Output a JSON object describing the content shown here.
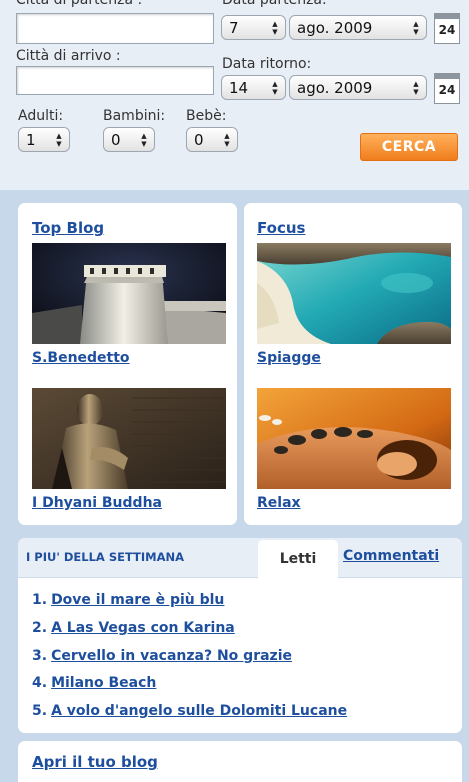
{
  "form": {
    "departure_city_label": "Città di partenza :",
    "departure_date_label": "Data partenza:",
    "arrival_city_label": "Città di arrivo :",
    "return_date_label": "Data ritorno:",
    "departure_day": "7",
    "departure_month": "ago. 2009",
    "return_day": "14",
    "return_month": "ago. 2009",
    "calendar_day": "24",
    "adults_label": "Adulti:",
    "children_label": "Bambini:",
    "infants_label": "Bebè:",
    "adults_value": "1",
    "children_value": "0",
    "infants_value": "0",
    "search_button": "CERCA"
  },
  "top_blog": {
    "title": "Top Blog",
    "items": [
      {
        "caption": "S.Benedetto",
        "image": "castle-tower-night"
      },
      {
        "caption": "I Dhyani Buddha",
        "image": "buddha-statue"
      }
    ]
  },
  "focus": {
    "title": "Focus",
    "items": [
      {
        "caption": "Spiagge",
        "image": "beach-cove"
      },
      {
        "caption": "Relax",
        "image": "hot-stone-massage"
      }
    ]
  },
  "week": {
    "title": "I PIU' DELLA SETTIMANA",
    "tab_read": "Letti",
    "tab_commented": "Commentati",
    "items": [
      {
        "num": "1.",
        "text": "Dove il mare è più blu"
      },
      {
        "num": "2.",
        "text": "A Las Vegas con Karina"
      },
      {
        "num": "3.",
        "text": "Cervello in vacanza? No grazie"
      },
      {
        "num": "4.",
        "text": "Milano Beach"
      },
      {
        "num": "5.",
        "text": "A volo d'angelo sulle Dolomiti Lucane"
      }
    ]
  },
  "open_blog": "Apri il tuo blog"
}
